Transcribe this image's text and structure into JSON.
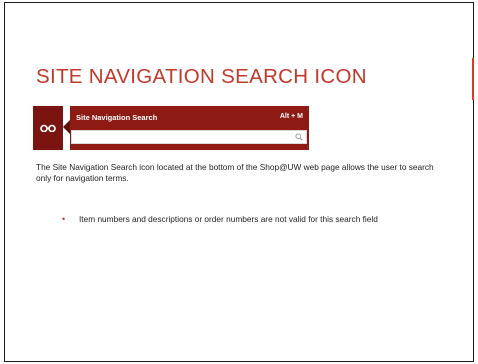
{
  "slide": {
    "title": "SITE NAVIGATION SEARCH ICON",
    "accent_color": "#c0392b"
  },
  "widget": {
    "icon": "binoculars-icon",
    "header_label": "Site Navigation Search",
    "shortcut": "Alt + M",
    "search_value": "",
    "search_icon": "magnifier-icon",
    "panel_color": "#8e1a14",
    "tab_color": "#7a1410"
  },
  "body": {
    "paragraph": "The Site Navigation Search icon located at the bottom of the Shop@UW web page allows the user to search only for navigation terms.",
    "bullets": [
      "Item numbers and descriptions or order numbers are not valid for this search field"
    ],
    "bullet_glyph": "•"
  }
}
